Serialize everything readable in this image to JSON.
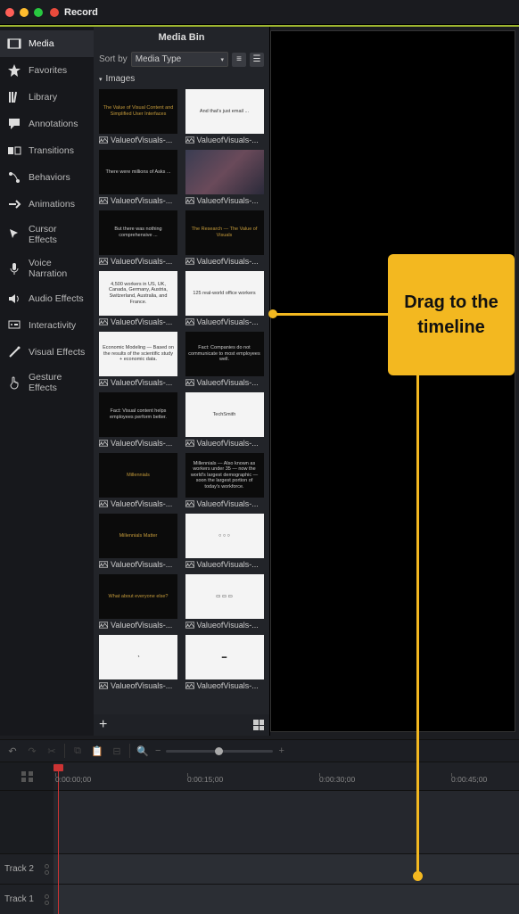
{
  "window": {
    "record_label": "Record"
  },
  "sidebar": {
    "items": [
      {
        "label": "Media"
      },
      {
        "label": "Favorites"
      },
      {
        "label": "Library"
      },
      {
        "label": "Annotations"
      },
      {
        "label": "Transitions"
      },
      {
        "label": "Behaviors"
      },
      {
        "label": "Animations"
      },
      {
        "label": "Cursor Effects"
      },
      {
        "label": "Voice Narration"
      },
      {
        "label": "Audio Effects"
      },
      {
        "label": "Interactivity"
      },
      {
        "label": "Visual Effects"
      },
      {
        "label": "Gesture Effects"
      }
    ]
  },
  "mediabin": {
    "title": "Media Bin",
    "sort_label": "Sort by",
    "sort_value": "Media Type",
    "section": "Images",
    "thumbs": [
      {
        "caption": "ValueofVisuals-...",
        "bg": "dark",
        "text": "The Value of Visual Content and Simplified User Interfaces",
        "accent": "#c49a3a"
      },
      {
        "caption": "ValueofVisuals-...",
        "bg": "white",
        "text": "And that's just email ..."
      },
      {
        "caption": "ValueofVisuals-...",
        "bg": "dark",
        "text": "There were millions of Asks ..."
      },
      {
        "caption": "ValueofVisuals-...",
        "bg": "photo",
        "text": ""
      },
      {
        "caption": "ValueofVisuals-...",
        "bg": "dark",
        "text": "But there was nothing comprehensive ..."
      },
      {
        "caption": "ValueofVisuals-...",
        "bg": "dark",
        "text": "The Research — The Value of Visuals",
        "accent": "#c49a3a"
      },
      {
        "caption": "ValueofVisuals-...",
        "bg": "white",
        "text": "4,500 workers in US, UK, Canada, Germany, Austria, Switzerland, Australia, and France."
      },
      {
        "caption": "ValueofVisuals-...",
        "bg": "white",
        "text": "125 real-world office workers"
      },
      {
        "caption": "ValueofVisuals-...",
        "bg": "white",
        "text": "Economic Modeling — Based on the results of the scientific study + economic data."
      },
      {
        "caption": "ValueofVisuals-...",
        "bg": "dark",
        "text": "Fact: Companies do not communicate to most employees well."
      },
      {
        "caption": "ValueofVisuals-...",
        "bg": "dark",
        "text": "Fact: Visual content helps employees perform better."
      },
      {
        "caption": "ValueofVisuals-...",
        "bg": "white",
        "text": "TechSmith"
      },
      {
        "caption": "ValueofVisuals-...",
        "bg": "dark",
        "text": "Millennials",
        "accent": "#c49a3a"
      },
      {
        "caption": "ValueofVisuals-...",
        "bg": "dark",
        "text": "Millennials — Also known as workers under 35 — now the world's largest demographic — soon the largest portion of today's workforce."
      },
      {
        "caption": "ValueofVisuals-...",
        "bg": "dark",
        "text": "Millennials Matter",
        "accent": "#c49a3a"
      },
      {
        "caption": "ValueofVisuals-...",
        "bg": "white",
        "text": "○ ○ ○"
      },
      {
        "caption": "ValueofVisuals-...",
        "bg": "dark",
        "text": "What about everyone else?",
        "accent": "#c49a3a"
      },
      {
        "caption": "ValueofVisuals-...",
        "bg": "white",
        "text": "▭ ▭ ▭"
      },
      {
        "caption": "ValueofVisuals-...",
        "bg": "white",
        "text": "◔"
      },
      {
        "caption": "ValueofVisuals-...",
        "bg": "white",
        "text": "▬"
      }
    ]
  },
  "timeline": {
    "ticks": [
      "0:00:00;00",
      "0:00:15;00",
      "0:00:30;00",
      "0:00:45;00"
    ],
    "tracks": [
      "Track 2",
      "Track 1"
    ]
  },
  "annotation": {
    "text": "Drag to the timeline"
  },
  "colors": {
    "traffic_close": "#ff5f57",
    "traffic_min": "#febc2e",
    "traffic_max": "#28c840"
  }
}
